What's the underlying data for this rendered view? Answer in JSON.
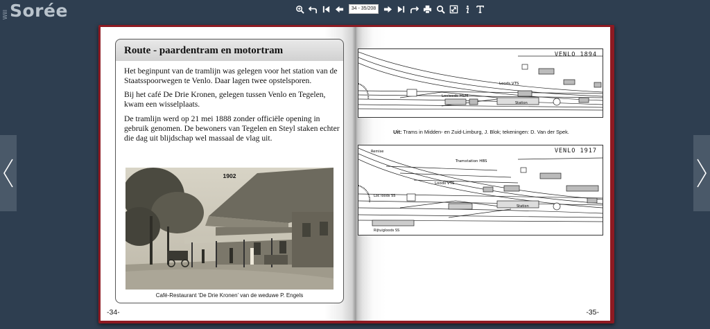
{
  "logo": {
    "small": "Will",
    "main": "Sorée"
  },
  "toolbar": {
    "page_indicator": "34 - 35/208",
    "icons": [
      "zoom-in-icon",
      "undo-icon",
      "first-page-icon",
      "prev-page-icon",
      "page-input",
      "next-page-icon",
      "last-page-icon",
      "redo-icon",
      "print-icon",
      "search-icon",
      "fullscreen-icon",
      "info-icon",
      "text-icon"
    ]
  },
  "left_page": {
    "title": "Route -  paardentram en motortram",
    "paragraphs": [
      "Het beginpunt van de tramlijn was gelegen voor het station van de Staatsspoorwegen te Venlo. Daar lagen twee opstelsporen.",
      "Bij het café De Drie Kronen, gelegen tussen Venlo en Tegelen, kwam een wisselplaats.",
      "De tramlijn werd op 21 mei 1888 zonder officiële opening in gebruik genomen. De bewoners van Tegelen en Steyl staken echter die dag uit blijdschap wel massaal de vlag uit."
    ],
    "photo_year": "1902",
    "caption": "Café-Restaurant ‘De Drie Kronen’ van de weduwe P. Engels",
    "page_number": "-34-"
  },
  "right_page": {
    "map1_title": "VENLO  1894",
    "map1_labels": {
      "loods": "Loods VTS",
      "locloods": "Locloods HSM",
      "station": "Station"
    },
    "caption_bold": "Uit:",
    "caption_rest": " Trams in Midden- en Zuid-Limburg, J. Blok; tekeningen: D. Van der Spek.",
    "map2_title": "VENLO  1917",
    "map2_labels": {
      "tramstation": "Tramstation HBS",
      "loods": "Loods VTS",
      "locloods": "Loc loods SS",
      "station": "Station",
      "rijtuigloods": "Rijtuigloods SS",
      "remise": "Remise"
    },
    "page_number": "-35-"
  },
  "colors": {
    "background": "#2e3e50",
    "book_cover": "#8e1a22",
    "nav": "#4a5969"
  }
}
